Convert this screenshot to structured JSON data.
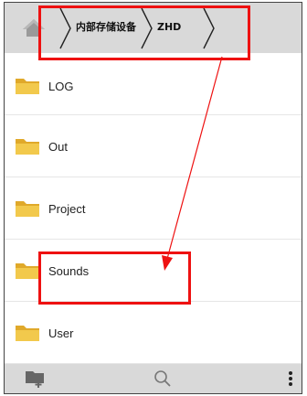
{
  "breadcrumb": {
    "home_icon": "home-icon",
    "crumbs": [
      "内部存储设备",
      "ZHD"
    ]
  },
  "folders": [
    {
      "name": "LOG",
      "icon": "folder-icon"
    },
    {
      "name": "Out",
      "icon": "folder-icon"
    },
    {
      "name": "Project",
      "icon": "folder-icon"
    },
    {
      "name": "Sounds",
      "icon": "folder-icon"
    },
    {
      "name": "User",
      "icon": "folder-icon"
    }
  ],
  "toolbar": {
    "new_folder_icon": "new-folder-icon",
    "search_icon": "search-icon",
    "menu_icon": "more-vertical-icon"
  },
  "colors": {
    "bar_background": "#d9d9d9",
    "annotation": "#ee1111",
    "folder_body": "#f2c94c",
    "folder_top": "#e0a92a"
  }
}
